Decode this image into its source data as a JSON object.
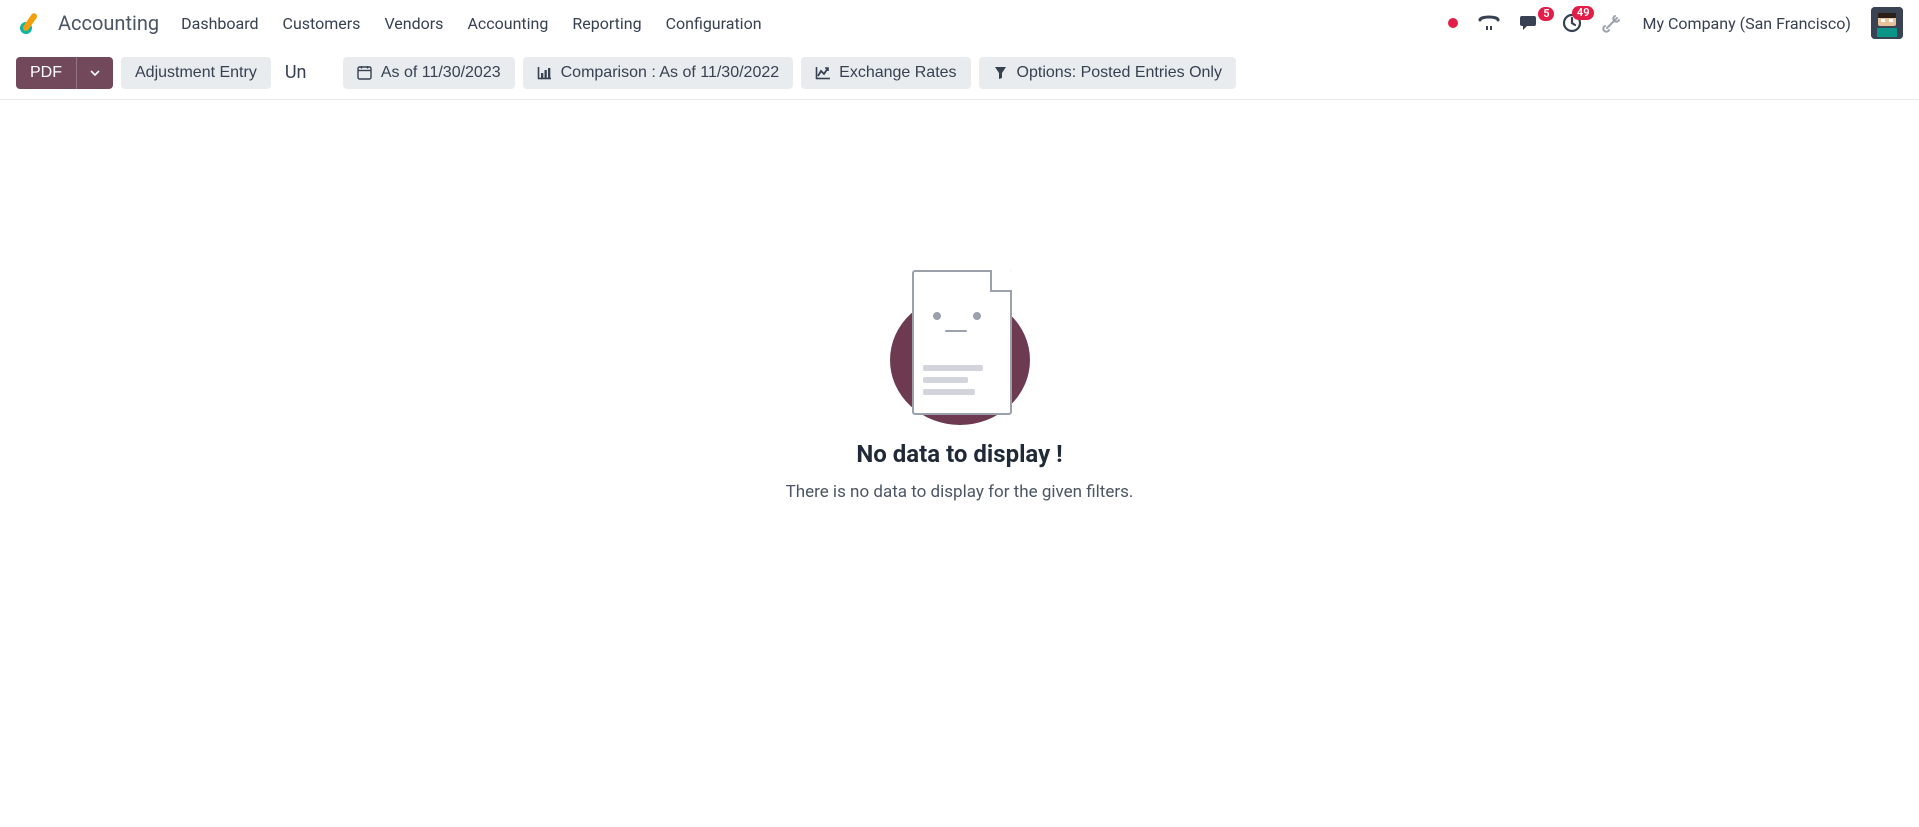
{
  "header": {
    "app_title": "Accounting",
    "nav": [
      "Dashboard",
      "Customers",
      "Vendors",
      "Accounting",
      "Reporting",
      "Configuration"
    ],
    "company": "My Company (San Francisco)",
    "badges": {
      "messages": "5",
      "activities": "49"
    }
  },
  "toolbar": {
    "pdf_label": "PDF",
    "adjustment_label": "Adjustment Entry",
    "truncated_text": "Un",
    "date_label": "As of 11/30/2023",
    "comparison_label": "Comparison : As of 11/30/2022",
    "exchange_label": "Exchange Rates",
    "options_label": "Options: Posted Entries Only"
  },
  "empty": {
    "title": "No data to display !",
    "subtitle": "There is no data to display for the given filters."
  }
}
